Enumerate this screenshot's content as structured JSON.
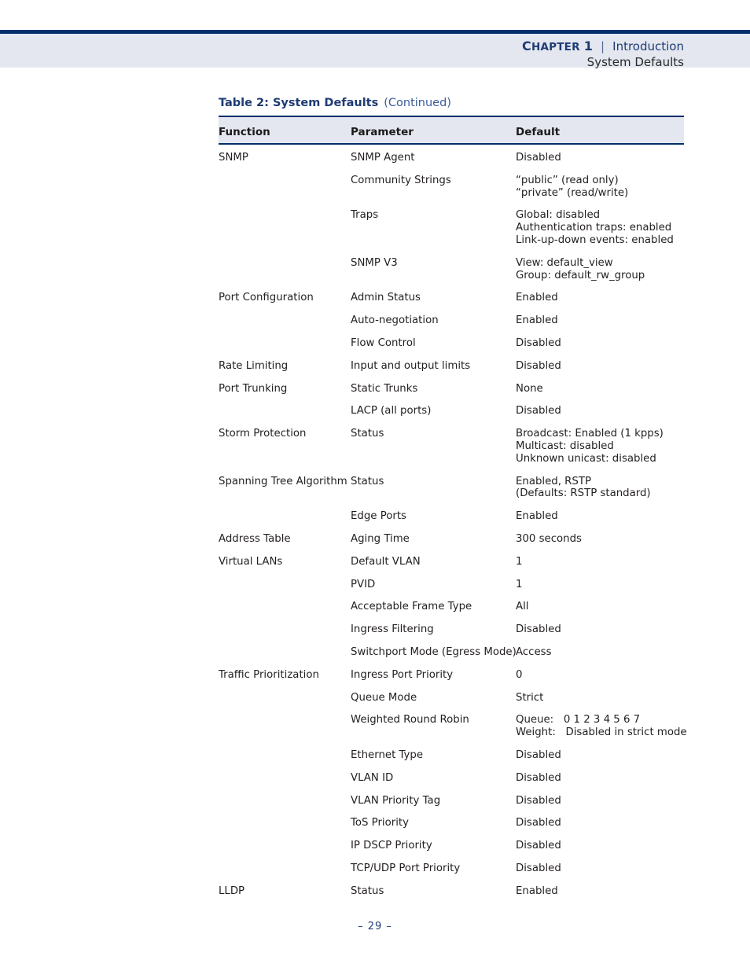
{
  "header": {
    "chapter_label": "Chapter",
    "chapter_label_cap": "C",
    "chapter_label_rest": "HAPTER",
    "chapter_number": "1",
    "separator": "|",
    "chapter_title": "Introduction",
    "section_title": "System Defaults"
  },
  "caption": {
    "title": "Table 2: System Defaults",
    "continued": "(Continued)"
  },
  "table": {
    "columns": [
      "Function",
      "Parameter",
      "Default"
    ],
    "rows": [
      {
        "function": "SNMP",
        "parameter": "SNMP Agent",
        "default": "Disabled"
      },
      {
        "function": "",
        "parameter": "Community Strings",
        "default": "“public” (read only)\n“private” (read/write)"
      },
      {
        "function": "",
        "parameter": "Traps",
        "default": "Global: disabled\nAuthentication traps: enabled\nLink-up-down events: enabled"
      },
      {
        "function": "",
        "parameter": "SNMP V3",
        "default": "View: default_view\nGroup: default_rw_group"
      },
      {
        "function": "Port Configuration",
        "parameter": "Admin Status",
        "default": "Enabled"
      },
      {
        "function": "",
        "parameter": "Auto-negotiation",
        "default": "Enabled"
      },
      {
        "function": "",
        "parameter": "Flow Control",
        "default": "Disabled"
      },
      {
        "function": "Rate Limiting",
        "parameter": "Input and output limits",
        "default": "Disabled"
      },
      {
        "function": "Port Trunking",
        "parameter": "Static Trunks",
        "default": "None"
      },
      {
        "function": "",
        "parameter": "LACP (all ports)",
        "default": "Disabled"
      },
      {
        "function": "Storm Protection",
        "parameter": "Status",
        "default": "Broadcast: Enabled (1 kpps)\nMulticast: disabled\nUnknown unicast: disabled"
      },
      {
        "function": "Spanning Tree Algorithm",
        "parameter": "Status",
        "default": "Enabled, RSTP\n(Defaults: RSTP standard)"
      },
      {
        "function": "",
        "parameter": "Edge Ports",
        "default": "Enabled"
      },
      {
        "function": "Address Table",
        "parameter": "Aging Time",
        "default": "300 seconds"
      },
      {
        "function": "Virtual LANs",
        "parameter": "Default VLAN",
        "default": "1"
      },
      {
        "function": "",
        "parameter": "PVID",
        "default": "1"
      },
      {
        "function": "",
        "parameter": "Acceptable Frame Type",
        "default": "All"
      },
      {
        "function": "",
        "parameter": "Ingress Filtering",
        "default": "Disabled"
      },
      {
        "function": "",
        "parameter": "Switchport Mode (Egress Mode)",
        "default": "Access"
      },
      {
        "function": "Traffic Prioritization",
        "parameter": "Ingress Port Priority",
        "default": "0"
      },
      {
        "function": "",
        "parameter": "Queue Mode",
        "default": "Strict"
      },
      {
        "function": "",
        "parameter": "Weighted Round Robin",
        "default": "Queue:   0 1 2 3 4 5 6 7\nWeight:   Disabled in strict mode"
      },
      {
        "function": "",
        "parameter": "Ethernet Type",
        "default": "Disabled"
      },
      {
        "function": "",
        "parameter": "VLAN ID",
        "default": "Disabled"
      },
      {
        "function": "",
        "parameter": "VLAN Priority Tag",
        "default": "Disabled"
      },
      {
        "function": "",
        "parameter": "ToS Priority",
        "default": "Disabled"
      },
      {
        "function": "",
        "parameter": "IP DSCP Priority",
        "default": "Disabled"
      },
      {
        "function": "",
        "parameter": "TCP/UDP Port Priority",
        "default": "Disabled"
      },
      {
        "function": "LLDP",
        "parameter": "Status",
        "default": "Enabled"
      }
    ]
  },
  "footer": {
    "page_marker": "–  29  –"
  },
  "colors": {
    "navy_rule": "#002f6c",
    "header_band": "#e4e7ef",
    "heading_blue": "#1f3b73",
    "continued_blue": "#3a5c9a",
    "body_text": "#231f20"
  }
}
